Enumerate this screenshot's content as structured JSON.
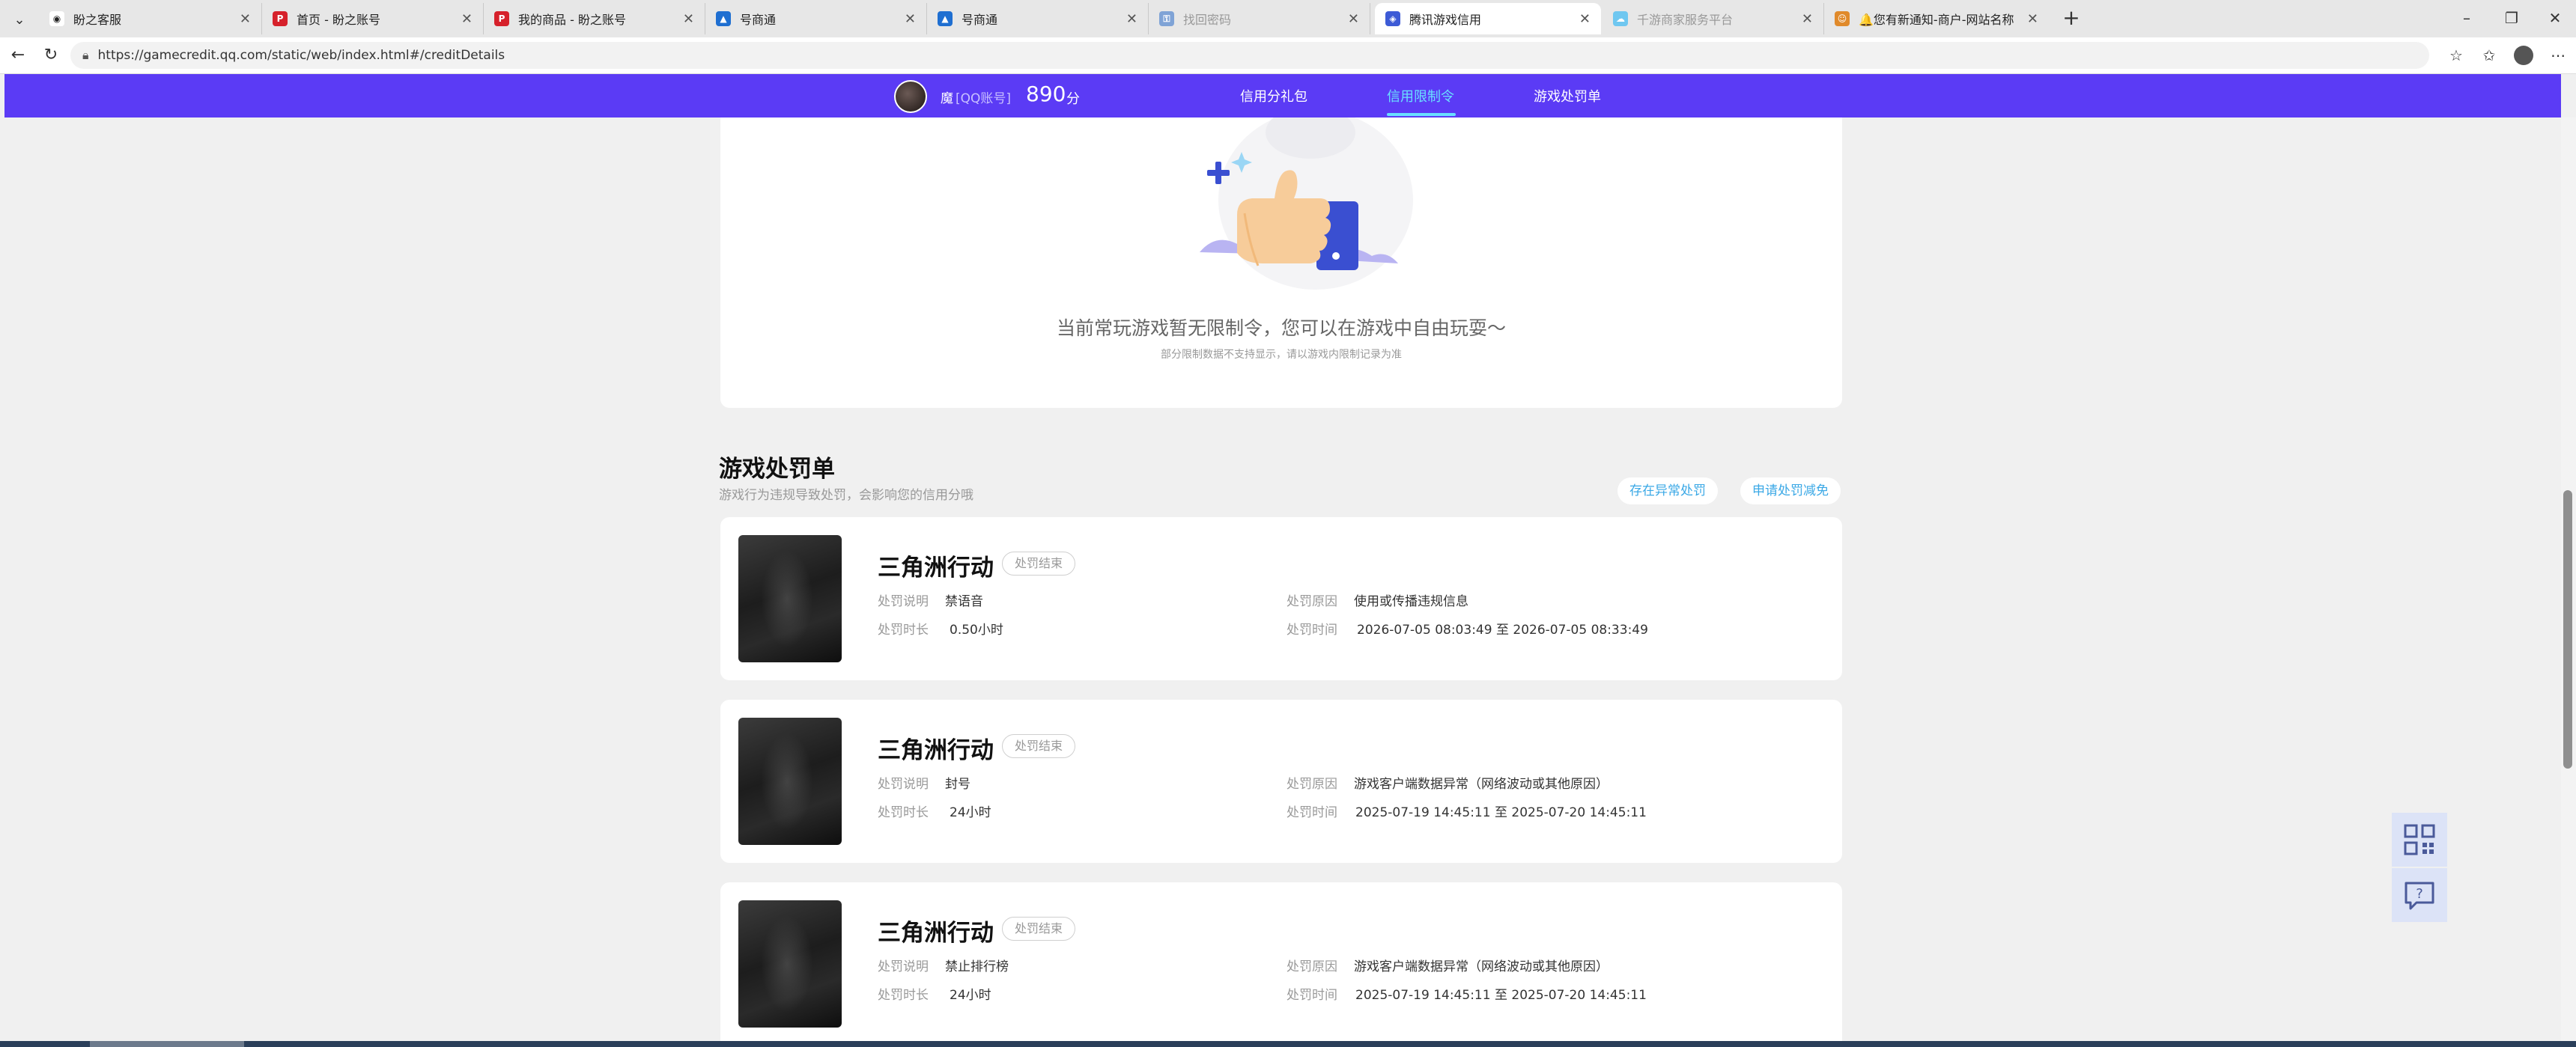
{
  "browser": {
    "tabs": [
      {
        "title": "盼之客服",
        "active": false,
        "dim": false,
        "favicon_color": "#222222",
        "icon": "panda-icon"
      },
      {
        "title": "首页 - 盼之账号",
        "active": false,
        "dim": false,
        "favicon_color": "#d6212b",
        "icon": "pz-logo-icon"
      },
      {
        "title": "我的商品 - 盼之账号",
        "active": false,
        "dim": false,
        "favicon_color": "#d6212b",
        "icon": "pz-logo-icon"
      },
      {
        "title": "号商通",
        "active": false,
        "dim": false,
        "favicon_color": "#1f6fd1",
        "icon": "bag-icon"
      },
      {
        "title": "号商通",
        "active": false,
        "dim": false,
        "favicon_color": "#1f6fd1",
        "icon": "bag-icon"
      },
      {
        "title": "找回密码",
        "active": false,
        "dim": true,
        "favicon_color": "#7fa3d6",
        "icon": "key-icon"
      },
      {
        "title": "腾讯游戏信用",
        "active": true,
        "dim": false,
        "favicon_color": "#3d5bd6",
        "icon": "shield-icon"
      },
      {
        "title": "千游商家服务平台",
        "active": false,
        "dim": true,
        "favicon_color": "#6fc7f0",
        "icon": "cloud-icon"
      },
      {
        "title": "🔔您有新通知-商户-网站名称",
        "active": false,
        "dim": false,
        "favicon_color": "#e08a2b",
        "icon": "bell-icon"
      }
    ],
    "url": "https://gamecredit.qq.com/static/web/index.html#/creditDetails"
  },
  "header": {
    "user_name": "魔",
    "account_type": "[QQ账号]",
    "score": "890",
    "score_unit": "分",
    "nav": [
      {
        "label": "信用分礼包",
        "active": false
      },
      {
        "label": "信用限制令",
        "active": true
      },
      {
        "label": "游戏处罚单",
        "active": false
      }
    ]
  },
  "restriction": {
    "message": "当前常玩游戏暂无限制令，您可以在游戏中自由玩耍～",
    "note": "部分限制数据不支持显示，请以游戏内限制记录为准"
  },
  "penalties": {
    "title": "游戏处罚单",
    "subtitle": "游戏行为违规导致处罚，会影响您的信用分哦",
    "btn_appeal": "存在异常处罚",
    "btn_reduce": "申请处罚减免",
    "labels": {
      "desc": "处罚说明",
      "duration": "处罚时长",
      "reason": "处罚原因",
      "time": "处罚时间",
      "to": "至"
    },
    "items": [
      {
        "game": "三角洲行动",
        "status": "处罚结束",
        "desc": "禁语音",
        "duration": "0.50小时",
        "reason": "使用或传播违规信息",
        "start": "2026-07-05 08:03:49",
        "end": "2026-07-05 08:33:49"
      },
      {
        "game": "三角洲行动",
        "status": "处罚结束",
        "desc": "封号",
        "duration": "24小时",
        "reason": "游戏客户端数据异常（网络波动或其他原因）",
        "start": "2025-07-19 14:45:11",
        "end": "2025-07-20 14:45:11"
      },
      {
        "game": "三角洲行动",
        "status": "处罚结束",
        "desc": "禁止排行榜",
        "duration": "24小时",
        "reason": "游戏客户端数据异常（网络波动或其他原因）",
        "start": "2025-07-19 14:45:11",
        "end": "2025-07-20 14:45:11"
      }
    ]
  },
  "colors": {
    "header_bg": "#5b3bf5",
    "nav_active": "#69e0ff",
    "pill_text": "#3aa8e6"
  }
}
